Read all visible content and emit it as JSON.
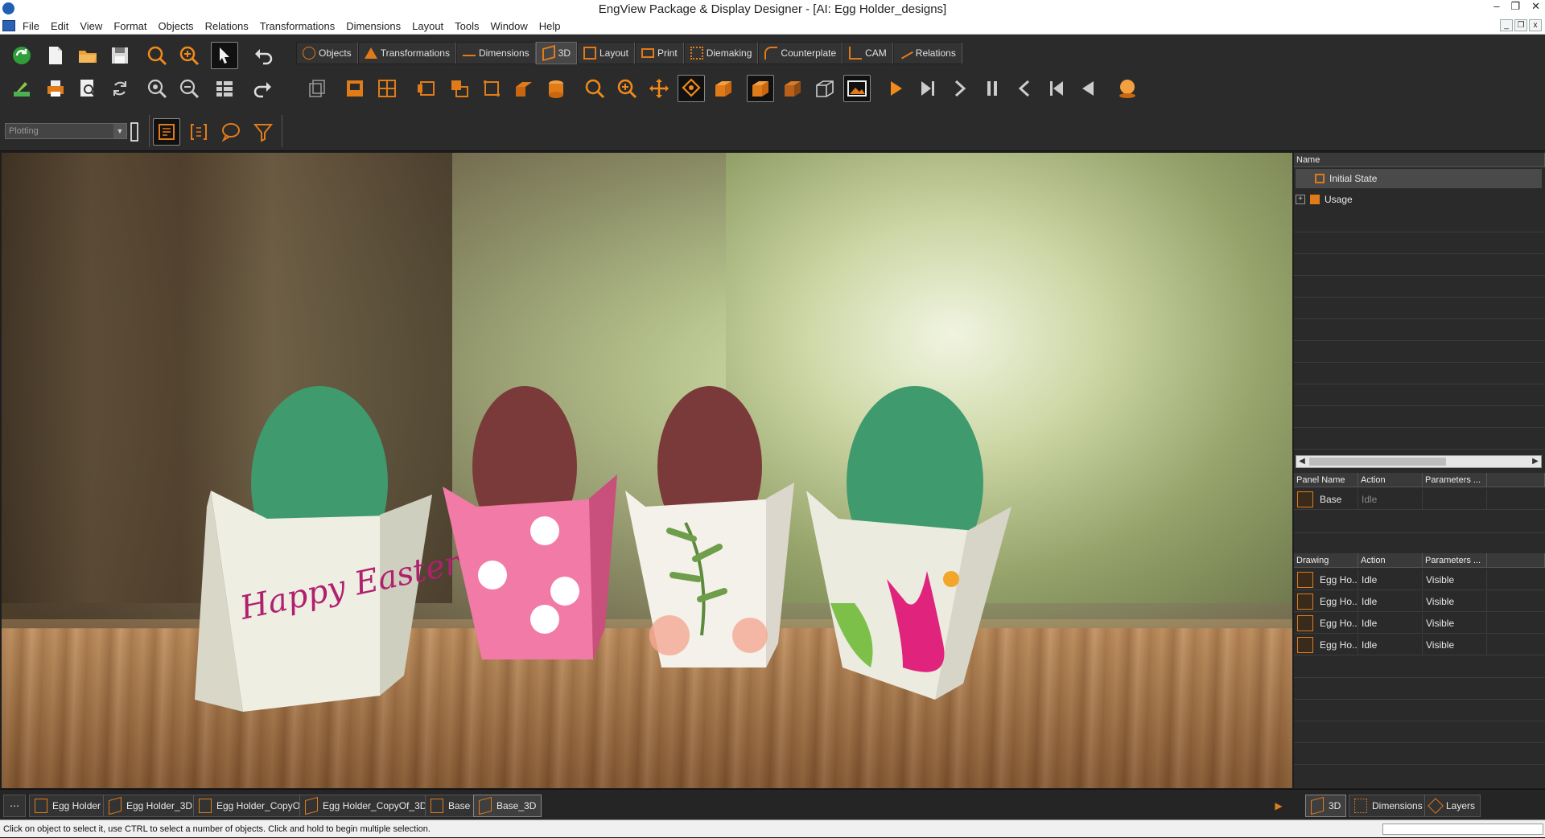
{
  "window": {
    "title": "EngView Package & Display Designer - [AI: Egg Holder_designs]"
  },
  "menu": [
    "File",
    "Edit",
    "View",
    "Format",
    "Objects",
    "Relations",
    "Transformations",
    "Dimensions",
    "Layout",
    "Tools",
    "Window",
    "Help"
  ],
  "ribbon_tabs": [
    {
      "label": "Objects",
      "icon": "objects-icon"
    },
    {
      "label": "Transformations",
      "icon": "transformations-icon"
    },
    {
      "label": "Dimensions",
      "icon": "dimensions-icon"
    },
    {
      "label": "3D",
      "icon": "cube-3d-icon",
      "active": true
    },
    {
      "label": "Layout",
      "icon": "layout-icon"
    },
    {
      "label": "Print",
      "icon": "print-icon"
    },
    {
      "label": "Diemaking",
      "icon": "diemaking-icon"
    },
    {
      "label": "Counterplate",
      "icon": "counterplate-icon"
    },
    {
      "label": "CAM",
      "icon": "cam-icon"
    },
    {
      "label": "Relations",
      "icon": "relations-icon"
    }
  ],
  "toolbar": {
    "plotting_select": "Plotting"
  },
  "animation_tree": {
    "header": "Name",
    "items": [
      {
        "label": "Initial State",
        "selected": true
      },
      {
        "label": "Usage",
        "expandable": true
      }
    ]
  },
  "panel_table": {
    "headers": [
      "Panel Name",
      "Action",
      "Parameters ..."
    ],
    "rows": [
      {
        "name": "Base",
        "action": "Idle",
        "params": ""
      }
    ]
  },
  "drawing_table": {
    "headers": [
      "Drawing",
      "Action",
      "Parameters ..."
    ],
    "rows": [
      {
        "name": "Egg Ho...",
        "action": "Idle",
        "params": "Visible"
      },
      {
        "name": "Egg Ho...",
        "action": "Idle",
        "params": "Visible"
      },
      {
        "name": "Egg Ho...",
        "action": "Idle",
        "params": "Visible"
      },
      {
        "name": "Egg Ho...",
        "action": "Idle",
        "params": "Visible"
      }
    ]
  },
  "document_tabs": [
    {
      "label": "Egg Holder",
      "icon": "drawing-2d-icon"
    },
    {
      "label": "Egg Holder_3D",
      "icon": "drawing-3d-icon"
    },
    {
      "label": "Egg Holder_CopyOf",
      "icon": "drawing-2d-icon"
    },
    {
      "label": "Egg Holder_CopyOf_3D",
      "icon": "drawing-3d-icon"
    },
    {
      "label": "Base",
      "icon": "drawing-2d-icon"
    },
    {
      "label": "Base_3D",
      "icon": "drawing-3d-icon",
      "active": true
    }
  ],
  "panel_tabs": [
    {
      "label": "3D",
      "active": true
    },
    {
      "label": "Dimensions"
    },
    {
      "label": "Layers"
    }
  ],
  "viewport_text": {
    "easter": "Happy Easter!"
  },
  "status": "Click on object to select it, use CTRL to select a number of objects. Click and hold to begin multiple selection.",
  "colors": {
    "accent": "#e07b1a",
    "egg_green": "#3f9a6e",
    "egg_brown": "#7b3a3a",
    "holder_pink": "#f27aa6"
  }
}
